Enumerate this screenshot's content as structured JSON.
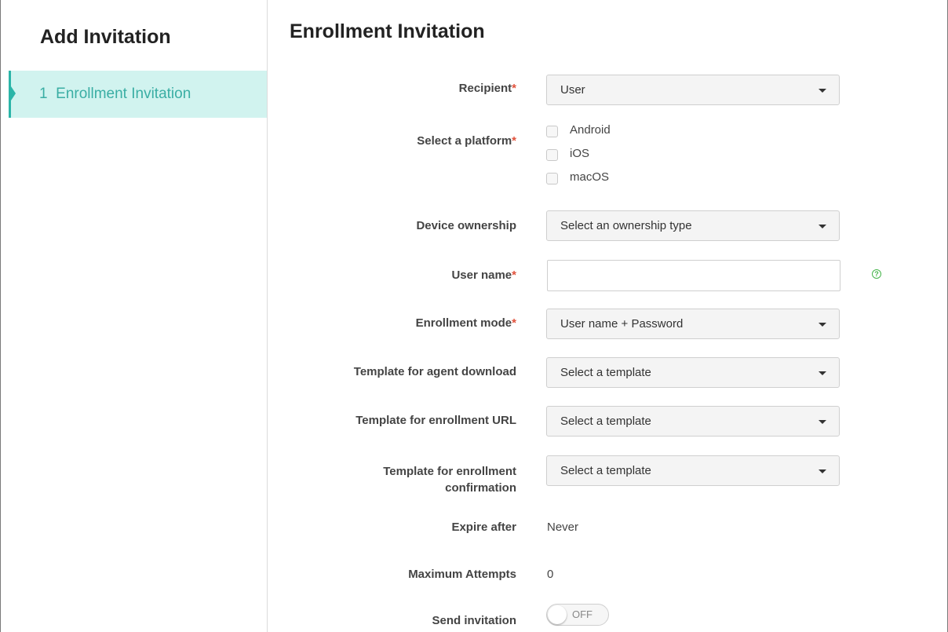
{
  "sidebar": {
    "title": "Add Invitation",
    "steps": [
      {
        "number": "1",
        "label": "Enrollment Invitation"
      }
    ]
  },
  "main": {
    "title": "Enrollment Invitation",
    "required_marker": "*",
    "recipient": {
      "label": "Recipient",
      "value": "User"
    },
    "platform": {
      "label": "Select a platform",
      "options": [
        "Android",
        "iOS",
        "macOS"
      ]
    },
    "device_ownership": {
      "label": "Device ownership",
      "value": "Select an ownership type"
    },
    "user_name": {
      "label": "User name",
      "value": "",
      "help": "?"
    },
    "enrollment_mode": {
      "label": "Enrollment mode",
      "value": "User name + Password"
    },
    "template_agent_download": {
      "label": "Template for agent download",
      "value": "Select a template"
    },
    "template_enrollment_url": {
      "label": "Template for enrollment URL",
      "value": "Select a template"
    },
    "template_enrollment_confirmation": {
      "label_line1": "Template for enrollment",
      "label_line2": "confirmation",
      "value": "Select a template"
    },
    "expire_after": {
      "label": "Expire after",
      "value": "Never"
    },
    "maximum_attempts": {
      "label": "Maximum Attempts",
      "value": "0"
    },
    "send_invitation": {
      "label": "Send invitation",
      "state": "OFF"
    }
  },
  "colors": {
    "accent": "#2bb5a8",
    "step_bg": "#d1f3ef",
    "required": "#e0523c",
    "help": "#45b44a"
  }
}
